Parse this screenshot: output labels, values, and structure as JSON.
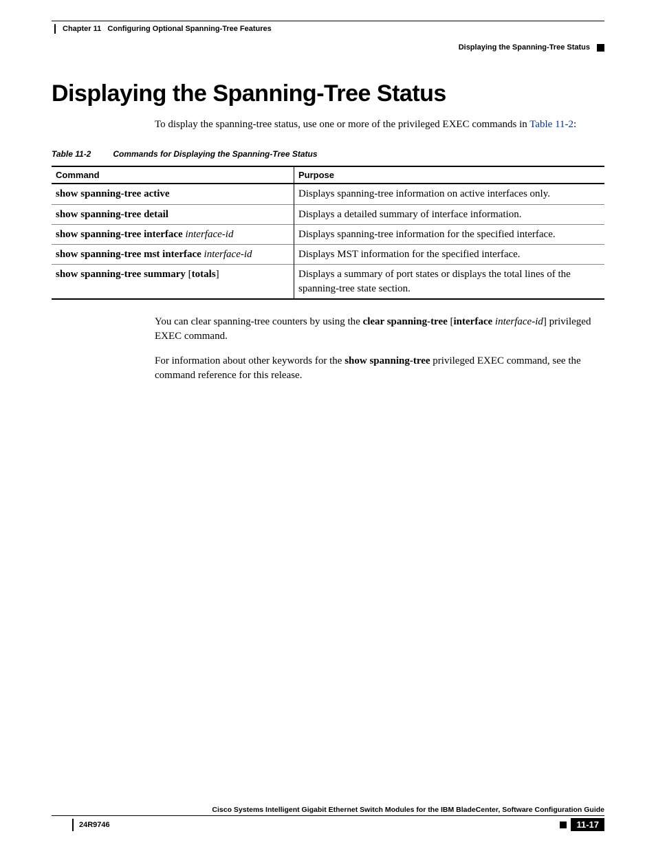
{
  "header": {
    "chapter_label": "Chapter 11",
    "chapter_title": "Configuring Optional Spanning-Tree Features",
    "section_title": "Displaying the Spanning-Tree Status"
  },
  "title": "Displaying the Spanning-Tree Status",
  "intro": {
    "pre": "To display the spanning-tree status, use one or more of the privileged EXEC commands in ",
    "xref": "Table 11-2",
    "post": ":"
  },
  "table": {
    "caption_num": "Table 11-2",
    "caption_title": "Commands for Displaying the Spanning-Tree Status",
    "col1": "Command",
    "col2": "Purpose",
    "rows": [
      {
        "cmd_bold": "show spanning-tree active",
        "cmd_italic": "",
        "purpose": "Displays spanning-tree information on active interfaces only."
      },
      {
        "cmd_bold": "show spanning-tree detail",
        "cmd_italic": "",
        "purpose": "Displays a detailed summary of interface information."
      },
      {
        "cmd_bold": "show spanning-tree interface ",
        "cmd_italic": "interface-id",
        "purpose": "Displays spanning-tree information for the specified interface."
      },
      {
        "cmd_bold": "show spanning-tree mst interface ",
        "cmd_italic": "interface-id",
        "purpose": "Displays MST information for the specified interface."
      },
      {
        "cmd_bold": "show spanning-tree summary ",
        "cmd_bracket": "[",
        "cmd_opt": "totals",
        "cmd_bracket2": "]",
        "purpose": "Displays a summary of port states or displays the total lines of the spanning-tree state section."
      }
    ]
  },
  "p1": {
    "a": "You can clear spanning-tree counters by using the ",
    "b": "clear spanning-tree ",
    "c": "[",
    "d": "interface ",
    "e": "interface-id",
    "f": "] privileged EXEC command."
  },
  "p2": {
    "a": "For information about other keywords for the ",
    "b": "show spanning-tree",
    "c": " privileged EXEC command, see the command reference for this release."
  },
  "footer": {
    "book": "Cisco Systems Intelligent Gigabit Ethernet Switch Modules for the IBM BladeCenter, Software Configuration Guide",
    "docnum": "24R9746",
    "pagenum": "11-17"
  }
}
